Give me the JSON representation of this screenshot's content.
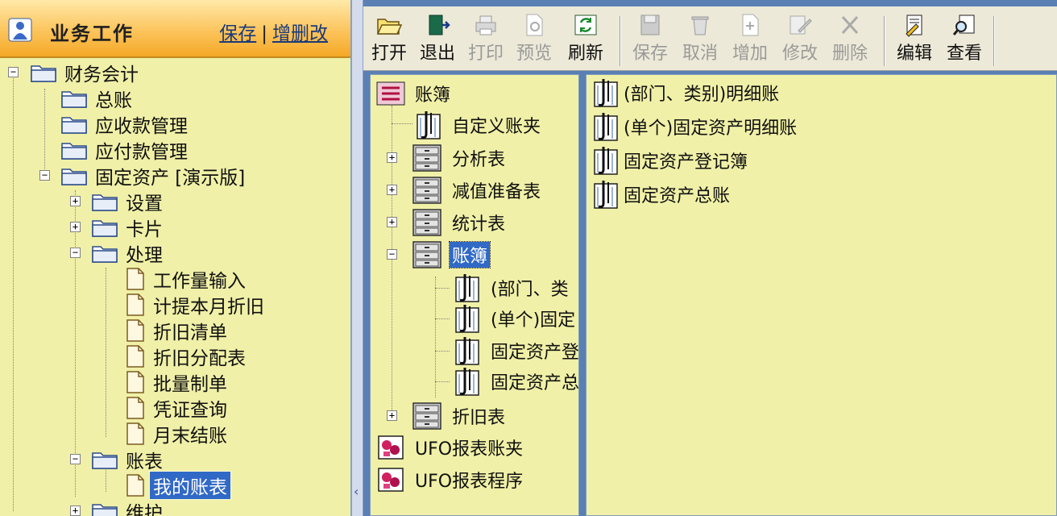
{
  "left": {
    "title": "业务工作",
    "links": {
      "save": "保存",
      "separator": "|",
      "edit": "增删改"
    },
    "tree": [
      {
        "label": "财务会计"
      },
      {
        "label": "总账"
      },
      {
        "label": "应收款管理"
      },
      {
        "label": "应付款管理"
      },
      {
        "label": "固定资产 [演示版]"
      },
      {
        "label": "设置"
      },
      {
        "label": "卡片"
      },
      {
        "label": "处理"
      },
      {
        "label": "工作量输入"
      },
      {
        "label": "计提本月折旧"
      },
      {
        "label": "折旧清单"
      },
      {
        "label": "折旧分配表"
      },
      {
        "label": "批量制单"
      },
      {
        "label": "凭证查询"
      },
      {
        "label": "月末结账"
      },
      {
        "label": "账表"
      },
      {
        "label": "我的账表"
      },
      {
        "label": "维护"
      }
    ]
  },
  "toolbar": {
    "open": "打开",
    "exit": "退出",
    "print": "打印",
    "preview": "预览",
    "refresh": "刷新",
    "save": "保存",
    "cancel": "取消",
    "add": "增加",
    "modify": "修改",
    "delete": "删除",
    "edit": "编辑",
    "view": "查看"
  },
  "mid_tree": [
    {
      "label": "账簿"
    },
    {
      "label": "自定义账夹"
    },
    {
      "label": "分析表"
    },
    {
      "label": "减值准备表"
    },
    {
      "label": "统计表"
    },
    {
      "label": "账簿"
    },
    {
      "label": "(部门、类"
    },
    {
      "label": "(单个)固定"
    },
    {
      "label": "固定资产登"
    },
    {
      "label": "固定资产总"
    },
    {
      "label": "折旧表"
    },
    {
      "label": "UFO报表账夹"
    },
    {
      "label": "UFO报表程序"
    }
  ],
  "list": [
    {
      "label": "(部门、类别)明细账"
    },
    {
      "label": "(单个)固定资产明细账"
    },
    {
      "label": "固定资产登记簿"
    },
    {
      "label": "固定资产总账"
    }
  ]
}
